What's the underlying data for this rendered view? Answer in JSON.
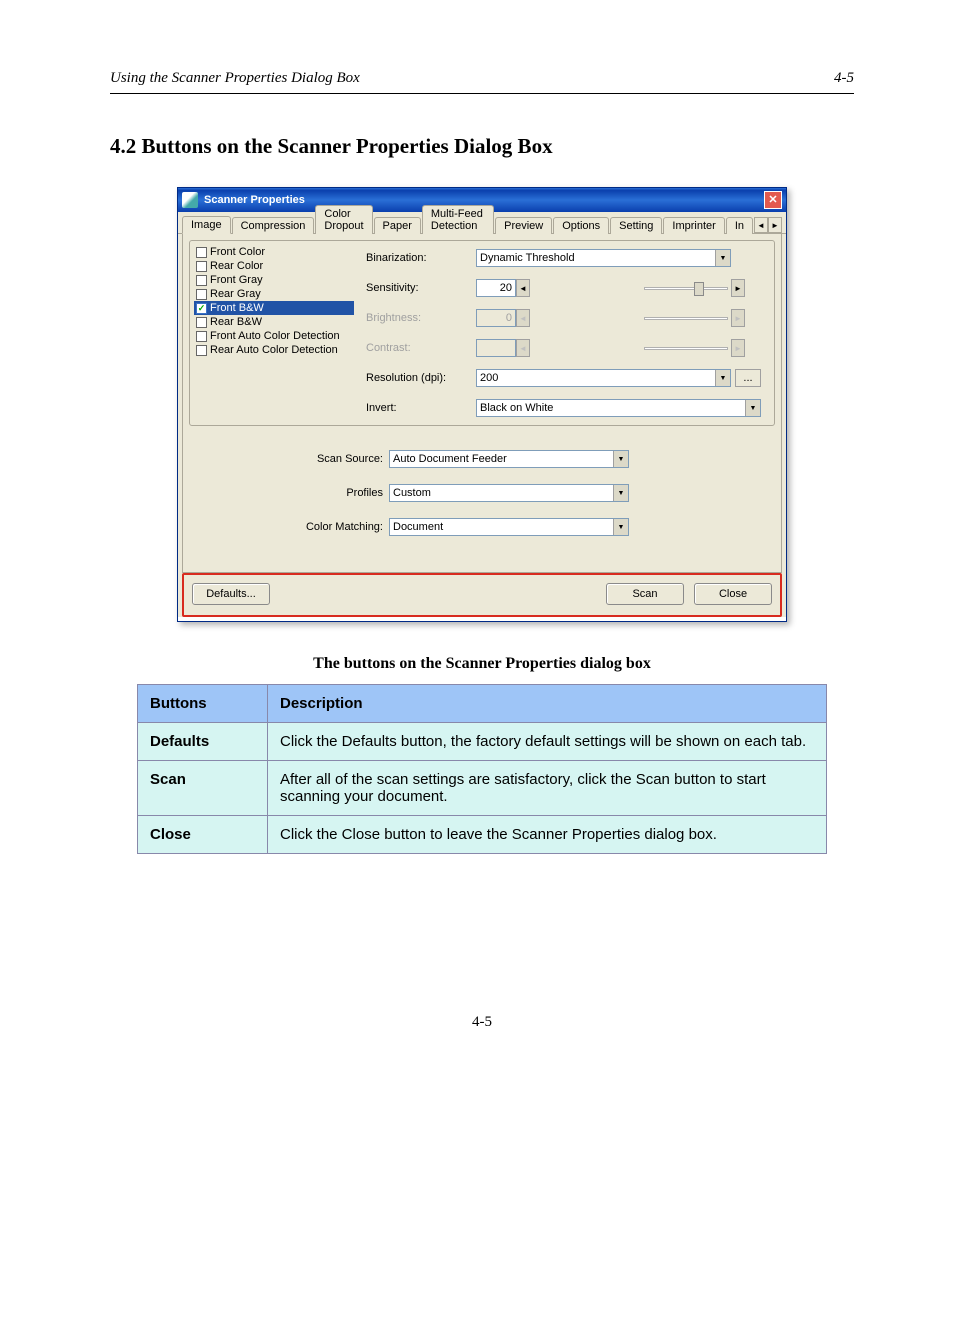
{
  "doc": {
    "header_left": "Using the Scanner Properties Dialog Box",
    "header_right": "4-5",
    "heading": "4.2 Buttons on the Scanner Properties Dialog Box",
    "intro": "The buttons on the Scanner Properties dialog box",
    "footer": "4-5"
  },
  "dialog": {
    "title": "Scanner Properties",
    "tabs": [
      "Image",
      "Compression",
      "Color Dropout",
      "Paper",
      "Multi-Feed Detection",
      "Preview",
      "Options",
      "Setting",
      "Imprinter",
      "In"
    ],
    "active_tab": "Image",
    "side_items": [
      {
        "label": "Front Color",
        "checked": false,
        "selected": false
      },
      {
        "label": "Rear Color",
        "checked": false,
        "selected": false
      },
      {
        "label": "Front Gray",
        "checked": false,
        "selected": false
      },
      {
        "label": "Rear Gray",
        "checked": false,
        "selected": false
      },
      {
        "label": "Front B&W",
        "checked": true,
        "selected": true
      },
      {
        "label": "Rear B&W",
        "checked": false,
        "selected": false
      },
      {
        "label": "Front Auto Color Detection",
        "checked": false,
        "selected": false
      },
      {
        "label": "Rear Auto Color Detection",
        "checked": false,
        "selected": false
      }
    ],
    "fields": {
      "binarization_label": "Binarization:",
      "binarization_value": "Dynamic Threshold",
      "sensitivity_label": "Sensitivity:",
      "sensitivity_value": "20",
      "brightness_label": "Brightness:",
      "brightness_value": "0",
      "contrast_label": "Contrast:",
      "contrast_value": "",
      "resolution_label": "Resolution (dpi):",
      "resolution_value": "200",
      "invert_label": "Invert:",
      "invert_value": "Black on White",
      "scan_source_label": "Scan Source:",
      "scan_source_value": "Auto Document Feeder",
      "profiles_label": "Profiles",
      "profiles_value": "Custom",
      "color_matching_label": "Color Matching:",
      "color_matching_value": "Document"
    },
    "buttons": {
      "defaults": "Defaults...",
      "scan": "Scan",
      "close": "Close",
      "dots": "..."
    }
  },
  "table": {
    "h1": "Buttons",
    "h2": "Description",
    "rows": [
      {
        "label": "Defaults",
        "desc": "Click the Defaults button, the factory default settings will be shown on each tab."
      },
      {
        "label": "Scan",
        "desc": "After all of the scan settings are satisfactory, click the Scan button to start scanning your document."
      },
      {
        "label": "Close",
        "desc": "Click the Close button to leave the Scanner Properties dialog box."
      }
    ]
  }
}
